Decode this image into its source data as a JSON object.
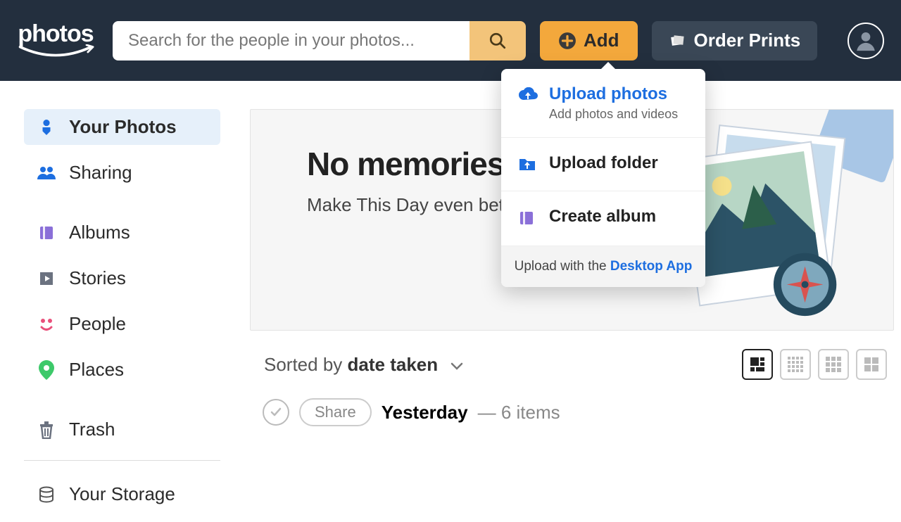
{
  "header": {
    "logo_text": "photos",
    "search_placeholder": "Search for the people in your photos...",
    "add_label": "Add",
    "order_label": "Order Prints"
  },
  "sidebar": {
    "items": [
      {
        "label": "Your Photos"
      },
      {
        "label": "Sharing"
      },
      {
        "label": "Albums"
      },
      {
        "label": "Stories"
      },
      {
        "label": "People"
      },
      {
        "label": "Places"
      },
      {
        "label": "Trash"
      }
    ],
    "storage_label": "Your Storage"
  },
  "banner": {
    "title": "No memories today",
    "subtitle": "Make This Day even better!"
  },
  "toolbar": {
    "sorted_prefix": "Sorted by ",
    "sorted_key": "date taken"
  },
  "group": {
    "share_label": "Share",
    "title": "Yesterday",
    "separator": " — ",
    "count_text": "6 items"
  },
  "dropdown": {
    "upload_photos": {
      "title": "Upload photos",
      "subtitle": "Add photos and videos"
    },
    "upload_folder": {
      "title": "Upload folder"
    },
    "create_album": {
      "title": "Create album"
    },
    "footer_prefix": "Upload with the ",
    "footer_link": "Desktop App"
  }
}
